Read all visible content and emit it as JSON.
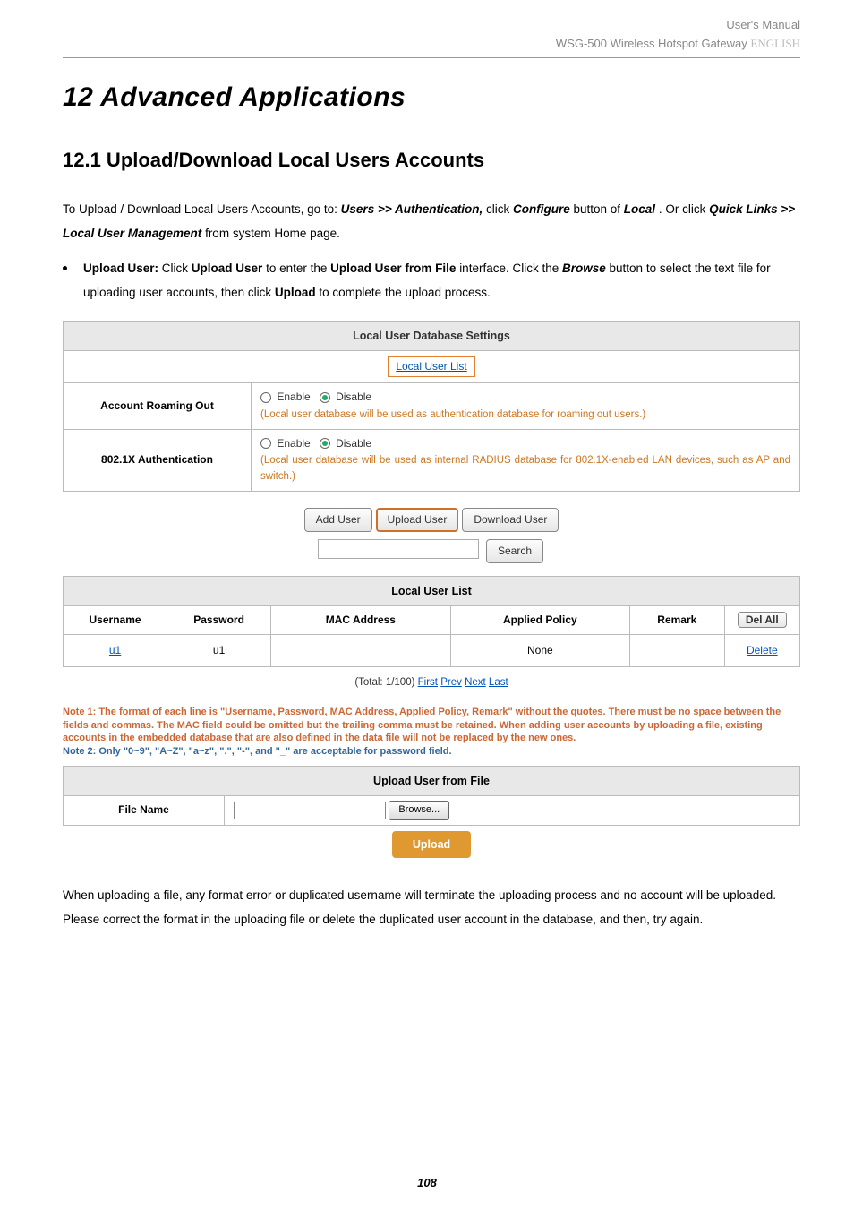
{
  "header": {
    "line1": "User's Manual",
    "line2_prefix": "WSG-500 Wireless Hotspot Gateway ",
    "line2_lang": "ENGLISH"
  },
  "h1": "12 Advanced Applications",
  "h2": "12.1 Upload/Download Local Users Accounts",
  "intro_prefix": "To Upload / Download Local Users Accounts, go to: ",
  "intro_path1": "Users >> Authentication,",
  "intro_mid1": " click ",
  "intro_configure": "Configure",
  "intro_mid2": " button of ",
  "intro_local": "Local",
  "intro_mid3": ". Or click ",
  "intro_path2": "Quick Links >> Local User Management",
  "intro_suffix": " from system Home page.",
  "bullet": {
    "lead_label": "Upload User:",
    "t1": " Click ",
    "b1": "Upload User",
    "t2": " to enter the ",
    "b2": "Upload User from File",
    "t3": " interface. Click the ",
    "b3": "Browse",
    "t4": " button to select the text file for uploading user accounts, then click ",
    "b4": "Upload",
    "t5": " to complete the upload process."
  },
  "settings": {
    "title": "Local User Database Settings",
    "local_user_list_link": "Local User List",
    "row1_label": "Account Roaming Out",
    "row2_label": "802.1X Authentication",
    "enable": "Enable",
    "disable": "Disable",
    "row1_help": "(Local user database will be used as authentication database for roaming out users.)",
    "row2_help": "(Local user database will be used as internal RADIUS database for 802.1X-enabled LAN devices, such as AP and switch.)"
  },
  "buttons": {
    "add_user": "Add User",
    "upload_user": "Upload User",
    "download_user": "Download User",
    "search": "Search"
  },
  "list": {
    "title": "Local User List",
    "cols": {
      "username": "Username",
      "password": "Password",
      "mac": "MAC Address",
      "policy": "Applied Policy",
      "remark": "Remark"
    },
    "del_all": "Del All",
    "row": {
      "username": "u1",
      "password": "u1",
      "mac": "",
      "policy": "None",
      "remark": "",
      "delete": "Delete"
    },
    "pager_text": "(Total: 1/100) ",
    "pager_first": "First",
    "pager_prev": "Prev",
    "pager_next": "Next",
    "pager_last": "Last"
  },
  "notes": {
    "l1": "Note 1: The format of each line is \"Username, Password, MAC Address, Applied Policy, Remark\" without the quotes. There must be no space between the fields and commas. The MAC field could be omitted but the trailing comma must be retained. When adding user accounts by uploading a file, existing accounts in the embedded database that are also defined in the data file will not be replaced by the new ones.",
    "l2": "Note 2: Only \"0~9\", \"A~Z\", \"a~z\", \".\", \"-\", and \"_\" are acceptable for password field."
  },
  "upload": {
    "title": "Upload User from File",
    "file_name": "File Name",
    "browse": "Browse...",
    "submit": "Upload"
  },
  "closing": "When uploading a file, any format error or duplicated username will terminate the uploading process and no account will be uploaded. Please correct the format in the uploading file or delete the duplicated user account in the database, and then, try again.",
  "page_number": "108"
}
